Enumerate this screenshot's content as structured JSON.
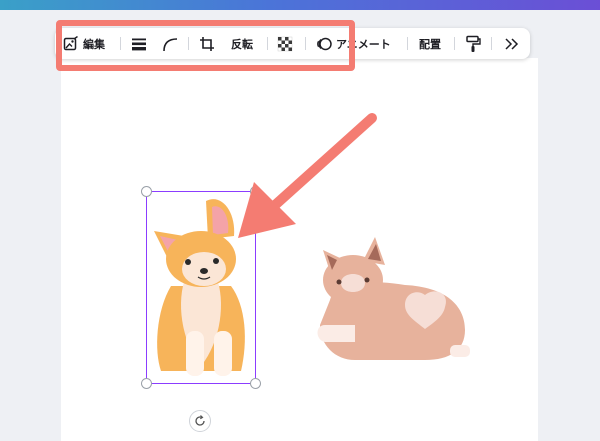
{
  "toolbar": {
    "edit_label": "編集",
    "flip_label": "反転",
    "animate_label": "アニメート",
    "position_label": "配置"
  },
  "icons": {
    "edit": "image-edit-icon",
    "border_weight": "border-weight-icon",
    "corner": "corner-rounding-icon",
    "crop": "crop-icon",
    "transparency": "transparency-icon",
    "animate": "animate-icon",
    "copy_style": "paint-roller-icon",
    "more": "double-chevron-right-icon",
    "rotate": "rotate-icon"
  },
  "colors": {
    "highlight": "#f47c72",
    "selection": "#8b3dff"
  }
}
